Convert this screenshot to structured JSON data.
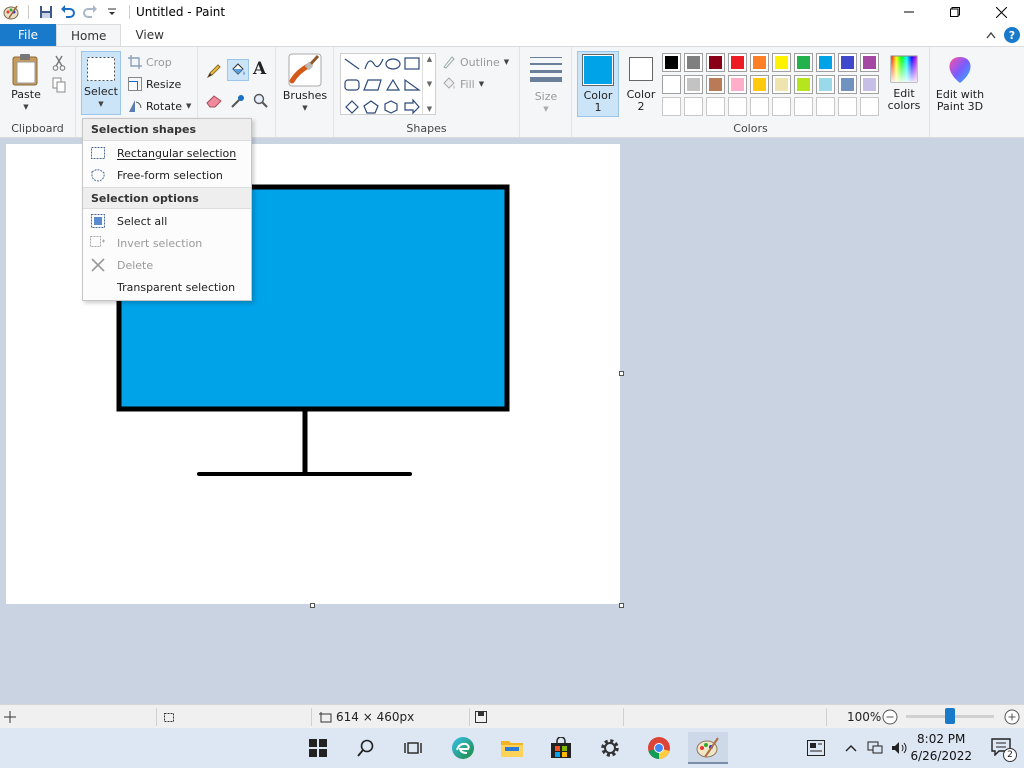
{
  "window": {
    "title": "Untitled - Paint"
  },
  "tabs": {
    "file": "File",
    "home": "Home",
    "view": "View"
  },
  "clipboard": {
    "paste": "Paste",
    "group": "Clipboard"
  },
  "image": {
    "select": "Select",
    "crop": "Crop",
    "resize": "Resize",
    "rotate": "Rotate"
  },
  "brushes": {
    "label": "Brushes"
  },
  "shapes": {
    "outline": "Outline",
    "fill": "Fill",
    "group": "Shapes"
  },
  "size": {
    "label": "Size"
  },
  "colors": {
    "color1_label": "Color",
    "color1_num": "1",
    "color2_label": "Color",
    "color2_num": "2",
    "edit_label_1": "Edit",
    "edit_label_2": "colors",
    "paint3d_1": "Edit with",
    "paint3d_2": "Paint 3D",
    "group": "Colors",
    "color1_value": "#00a2e8",
    "color2_value": "#ffffff",
    "palette_row1": [
      "#000000",
      "#7f7f7f",
      "#880015",
      "#ed1c24",
      "#ff7f27",
      "#fff200",
      "#22b14c",
      "#00a2e8",
      "#3f48cc",
      "#a349a4"
    ],
    "palette_row2": [
      "#ffffff",
      "#c3c3c3",
      "#b97a57",
      "#ffaec9",
      "#ffc90e",
      "#efe4b0",
      "#b5e61d",
      "#99d9ea",
      "#7092be",
      "#c8bfe7"
    ]
  },
  "dropdown": {
    "header1": "Selection shapes",
    "rect": "Rectangular selection",
    "freeform": "Free-form selection",
    "header2": "Selection options",
    "select_all": "Select all",
    "invert": "Invert selection",
    "delete": "Delete",
    "transparent": "Transparent selection"
  },
  "drawing": {
    "monitor_color": "#00a2e8"
  },
  "status": {
    "dimensions": "614 × 460px",
    "zoom": "100%",
    "zoom_level_percent": 100
  },
  "taskbar": {
    "time": "8:02 PM",
    "date": "6/26/2022",
    "notif_count": "2"
  }
}
